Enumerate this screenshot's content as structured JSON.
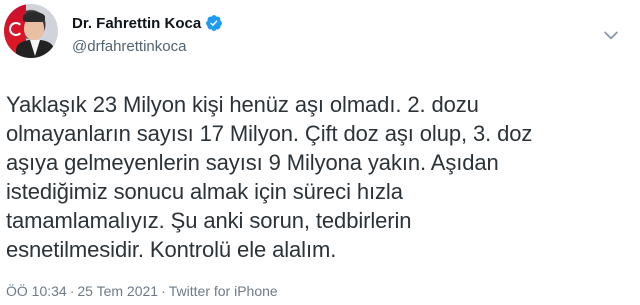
{
  "author": {
    "display_name": "Dr. Fahrettin Koca",
    "handle": "@drfahrettinkoca",
    "verified": true
  },
  "tweet": {
    "lines": [
      "Yaklaşık 23 Milyon kişi henüz aşı olmadı. 2. dozu",
      "olmayanların sayısı 17 Milyon. Çift doz aşı olup, 3. doz",
      "aşıya gelmeyenlerin sayısı 9 Milyona yakın. Aşıdan",
      "istediğimiz sonucu almak için süreci hızla",
      "tamamlamalıyız. Şu anki sorun, tedbirlerin",
      "esnetilmesidir. Kontrolü ele alalım."
    ]
  },
  "meta": {
    "time": "ÖÖ 10:34",
    "date": "25 Tem 2021",
    "source": "Twitter for iPhone"
  },
  "colors": {
    "verified_blue": "#1d9bf0",
    "muted": "#536471"
  },
  "icons": {
    "verified": "verified-badge-icon",
    "more": "chevron-down-icon"
  }
}
